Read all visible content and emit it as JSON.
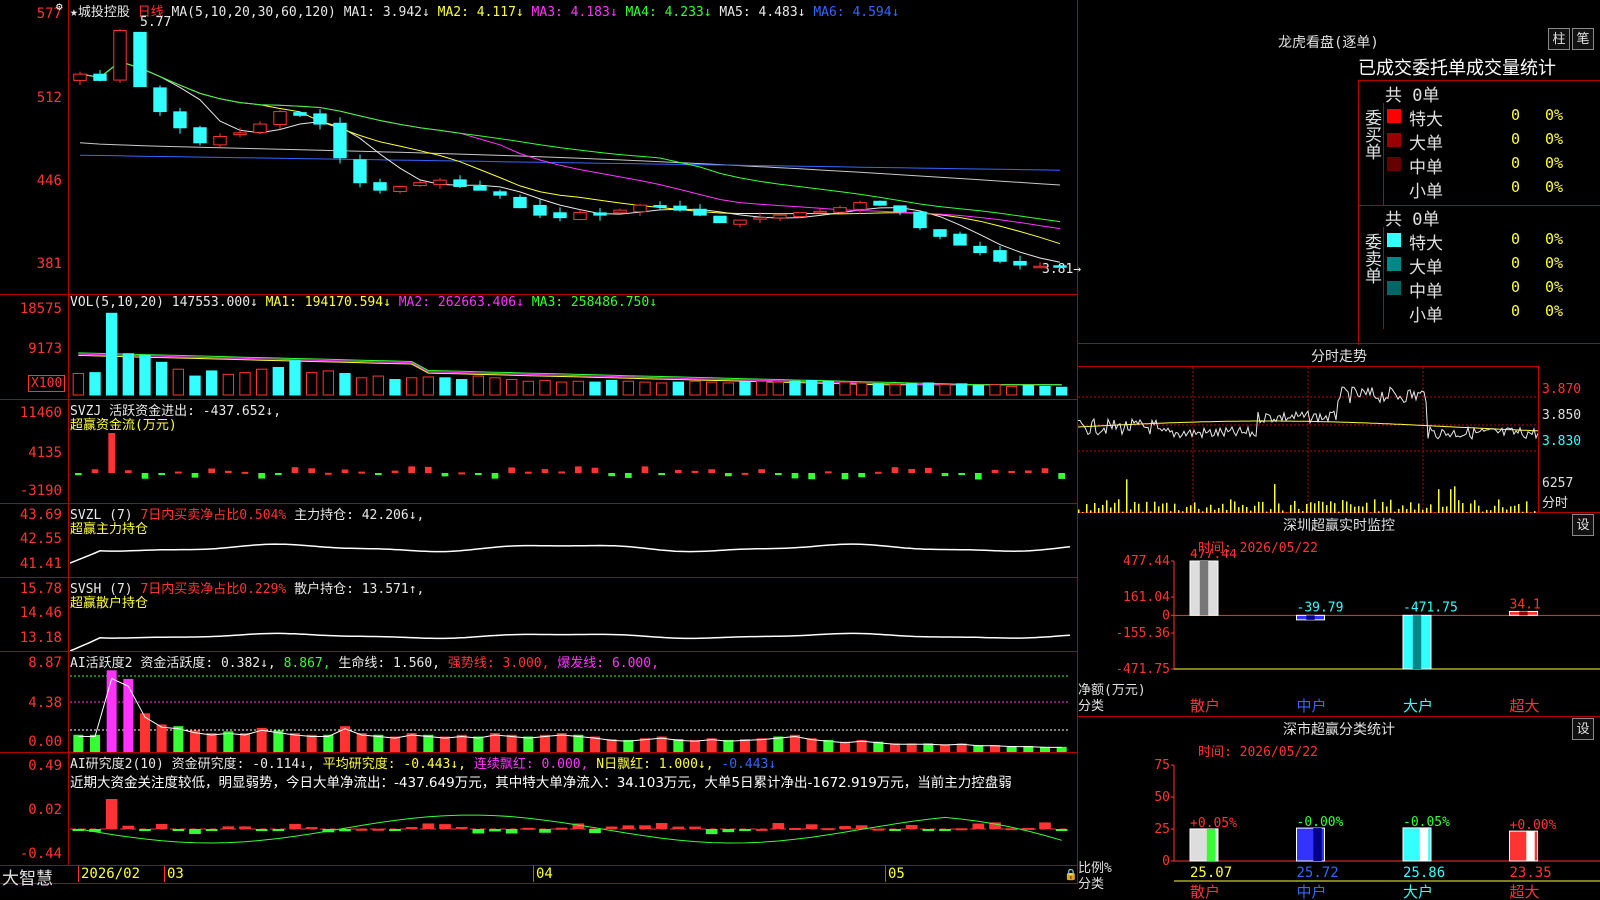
{
  "main_chart": {
    "stock_name": "★城投控股",
    "period": "日线",
    "ma_params": "MA(5,10,20,30,60,120)",
    "ma": [
      {
        "label": "MA1: 3.942↓",
        "color": "#e8e8e8"
      },
      {
        "label": "MA2: 4.117↓",
        "color": "#ffff33"
      },
      {
        "label": "MA3: 4.183↓",
        "color": "#ff33ff"
      },
      {
        "label": "MA4: 4.233↓",
        "color": "#33ff33"
      },
      {
        "label": "MA5: 4.483↓",
        "color": "#e8e8e8"
      },
      {
        "label": "MA6: 4.594↓",
        "color": "#3366ff"
      }
    ],
    "y_ticks": [
      "577",
      "512",
      "446",
      "381"
    ],
    "high_note": "5.77",
    "low_note": "3.81→",
    "corner_icon": "settings-icon"
  },
  "vol_panel": {
    "header": "VOL(5,10,20)",
    "value": "147553.000↓",
    "ma1": "MA1: 194170.594↓",
    "ma2": "MA2: 262663.406↓",
    "ma3": "MA3: 258486.750↓",
    "y_ticks": [
      "18575",
      "9173"
    ],
    "unit": "X100"
  },
  "svzj_panel": {
    "header": "SVZJ",
    "label": "活跃资金进出: -437.652↓,",
    "subtitle": "超赢资金流(万元)",
    "y_ticks": [
      "11460",
      "4135",
      "-3190"
    ]
  },
  "svzl_panel": {
    "header": "SVZL (7)",
    "label1": "7日内买卖净占比0.504%",
    "label2": "主力持仓: 42.206↓,",
    "subtitle": "超赢主力持仓",
    "y_ticks": [
      "43.69",
      "42.55",
      "41.41"
    ]
  },
  "svsh_panel": {
    "header": "SVSH (7)",
    "label1": "7日内买卖净占比0.229%",
    "label2": "散户持仓: 13.571↑,",
    "subtitle": "超赢散户持仓",
    "y_ticks": [
      "15.78",
      "14.46",
      "13.18"
    ]
  },
  "ai_active_panel": {
    "header": "AI活跃度2",
    "label1": "资金活跃度: 0.382↓,",
    "label2": "8.867,",
    "label3": "生命线: 1.560,",
    "label4": "强势线: 3.000,",
    "label5": "爆发线: 6.000,",
    "y_ticks": [
      "8.87",
      "4.38",
      "0.00"
    ]
  },
  "ai_research_panel": {
    "header": "AI研究度2(10)",
    "label1": "资金研究度: -0.114↓,",
    "label2": "平均研究度: -0.443↓,",
    "label3": "连续飘红: 0.000,",
    "label4": "N日飘红: 1.000↓,",
    "label5": "-0.443↓",
    "note": "近期大资金关注度较低，明显弱势，今日大单净流出：-437.649万元，其中特大单净流入：34.103万元，大单5日累计净出-1672.919万元，当前主力控盘弱",
    "y_ticks": [
      "0.49",
      "0.02",
      "-0.44"
    ]
  },
  "x_axis": {
    "logo": "大智慧",
    "labels": [
      "2026/02",
      "03",
      "04",
      "05"
    ]
  },
  "lhb": {
    "title": "龙虎看盘(逐单)",
    "btn1": "柱",
    "btn2": "笔",
    "subtitle": "已成交委托单成交量统计",
    "buy_side": "委买单",
    "sell_side": "委卖单",
    "buy_total": "共 0单",
    "sell_total": "共 0单",
    "buy_rows": [
      {
        "name": "特大",
        "count": "0",
        "pct": "0%",
        "color": "#ff0000"
      },
      {
        "name": "大单",
        "count": "0",
        "pct": "0%",
        "color": "#990000"
      },
      {
        "name": "中单",
        "count": "0",
        "pct": "0%",
        "color": "#660000"
      },
      {
        "name": "小单",
        "count": "0",
        "pct": "0%",
        "color": "#000000"
      }
    ],
    "sell_rows": [
      {
        "name": "特大",
        "count": "0",
        "pct": "0%",
        "color": "#33ffff"
      },
      {
        "name": "大单",
        "count": "0",
        "pct": "0%",
        "color": "#008888"
      },
      {
        "name": "中单",
        "count": "0",
        "pct": "0%",
        "color": "#006666"
      },
      {
        "name": "小单",
        "count": "0",
        "pct": "0%",
        "color": "#000000"
      }
    ]
  },
  "intraday": {
    "title": "分时走势",
    "y_ticks": [
      "3.870",
      "3.850",
      "3.830"
    ],
    "vol_tick": "6257",
    "unit": "分时"
  },
  "sz_monitor": {
    "title": "深圳超赢实时监控",
    "btn": "设",
    "time_label": "时间: 2026/05/22",
    "y_ticks": [
      "477.44",
      "161.04",
      "0",
      "-155.36",
      "-471.75"
    ],
    "ylabel1": "净额(万元)",
    "ylabel2": "分类",
    "categories": [
      "散户",
      "中户",
      "大户",
      "超大"
    ],
    "values_text": [
      "477.44",
      "-39.79",
      "-471.75",
      "34.1"
    ]
  },
  "sz_class": {
    "title": "深市超赢分类统计",
    "btn": "设",
    "time_label": "时间: 2026/05/22",
    "y_ticks": [
      "75",
      "50",
      "25",
      "0"
    ],
    "ylabel1": "比例%",
    "ylabel2": "分类",
    "categories": [
      "散户",
      "中户",
      "大户",
      "超大"
    ],
    "change_text": [
      "+0.05%",
      "-0.00%",
      "-0.05%",
      "+0.00%"
    ],
    "values_text": [
      "25.07",
      "25.72",
      "25.86",
      "23.35"
    ]
  },
  "chart_data": [
    {
      "type": "bar",
      "title": "深圳超赢实时监控",
      "ylabel": "净额(万元)",
      "xlabel": "分类",
      "categories": [
        "散户",
        "中户",
        "大户",
        "超大"
      ],
      "values": [
        477.44,
        -39.79,
        -471.75,
        34.1
      ],
      "ylim": [
        -471.75,
        477.44
      ]
    },
    {
      "type": "bar",
      "title": "深市超赢分类统计",
      "ylabel": "比例%",
      "xlabel": "分类",
      "categories": [
        "散户",
        "中户",
        "大户",
        "超大"
      ],
      "values": [
        25.07,
        25.72,
        25.86,
        23.35
      ],
      "ylim": [
        0,
        75
      ]
    }
  ]
}
